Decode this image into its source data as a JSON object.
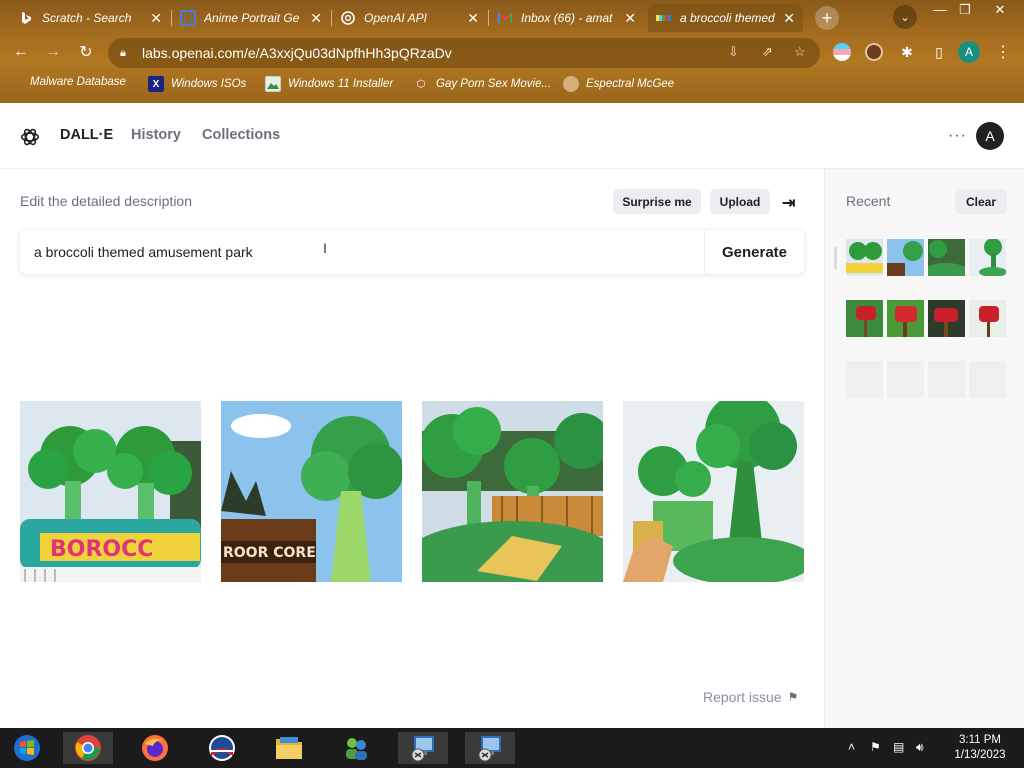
{
  "browser": {
    "tabs": [
      {
        "title": "Scratch - Search",
        "icon": "bing-icon"
      },
      {
        "title": "Anime Portrait Ge",
        "icon": "doc-icon"
      },
      {
        "title": "OpenAI API",
        "icon": "openai-icon"
      },
      {
        "title": "Inbox (66) - amat",
        "icon": "gmail-icon"
      },
      {
        "title": "a broccoli themed",
        "icon": "dalle-icon"
      }
    ],
    "url": "labs.openai.com/e/A3xxjQu03dNpfhHh3pQRzaDv",
    "profile_initial": "A",
    "bookmarks": [
      {
        "label": "Malware Database",
        "icon": "none"
      },
      {
        "label": "Windows ISOs",
        "icon": "x-icon"
      },
      {
        "label": "Windows 11 Installer",
        "icon": "image-icon"
      },
      {
        "label": "Gay Porn Sex Movie...",
        "icon": "cube-icon"
      },
      {
        "label": "Espectral McGee",
        "icon": "avatar-icon"
      }
    ]
  },
  "app": {
    "brand": "DALL·E",
    "nav": [
      "History",
      "Collections"
    ],
    "avatar_initial": "A",
    "more_label": "···"
  },
  "editor": {
    "label": "Edit the detailed description",
    "surprise_label": "Surprise me",
    "upload_label": "Upload",
    "prompt": "a broccoli themed amusement park",
    "generate_label": "Generate",
    "report_label": "Report issue",
    "images": [
      {
        "caption": "BOROCC"
      },
      {
        "caption": "ROOR CORE"
      },
      {
        "caption": ""
      },
      {
        "caption": ""
      }
    ]
  },
  "sidebar": {
    "recent_label": "Recent",
    "clear_label": "Clear",
    "thumb_count": 8
  },
  "taskbar": {
    "time": "3:11 PM",
    "date": "1/13/2023"
  },
  "colors": {
    "accent_dark": "#202123",
    "muted": "#6e6e80",
    "broccoli_green": "#2e9b3a",
    "mailbox_red": "#c8202a"
  }
}
